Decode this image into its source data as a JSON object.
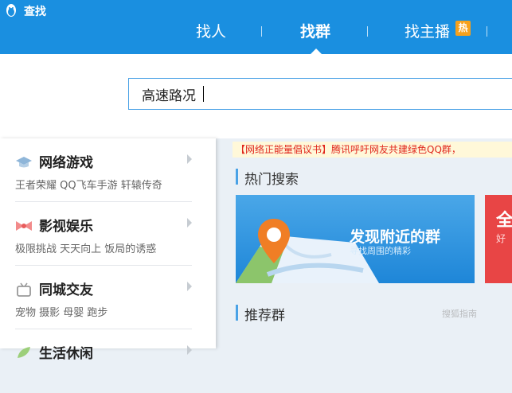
{
  "app": {
    "title": "查找"
  },
  "tabs": [
    {
      "label": "找人"
    },
    {
      "label": "找群"
    },
    {
      "label": "找主播",
      "badge": "热"
    }
  ],
  "search": {
    "value": "高速路况"
  },
  "sidebar": {
    "categories": [
      {
        "title": "网络游戏",
        "subtitle": "王者荣耀 QQ飞车手游 轩辕传奇",
        "icon": "graduation-cap-icon"
      },
      {
        "title": "影视娱乐",
        "subtitle": "极限挑战 天天向上 饭局的诱惑",
        "icon": "bow-icon"
      },
      {
        "title": "同城交友",
        "subtitle": "宠物 摄影 母婴 跑步",
        "icon": "tv-icon"
      },
      {
        "title": "生活休闲",
        "subtitle": "",
        "icon": "leaf-icon"
      }
    ]
  },
  "main": {
    "notice": "【网络正能量倡议书】腾讯呼吁网友共建绿色QQ群，",
    "hot_title": "热门搜索",
    "banner": {
      "title": "发现附近的群",
      "subtitle": "寻找周围的精彩"
    },
    "banner2": {
      "title": "全",
      "subtitle": "好"
    },
    "recommend_title": "推荐群"
  },
  "watermark": "搜狐指南",
  "colors": {
    "topbar": "#1a8fe0",
    "accent": "#4aa2e6",
    "hot_badge": "#f7a11c",
    "notice_text": "#e0261c"
  }
}
